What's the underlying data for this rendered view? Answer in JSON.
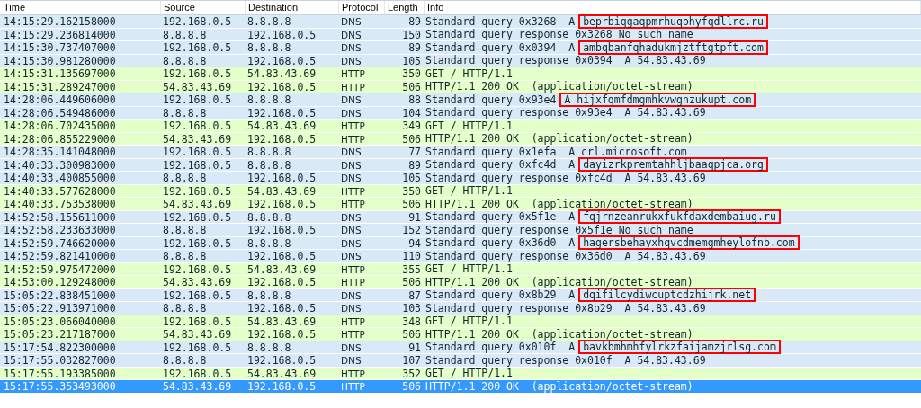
{
  "columns": [
    "Time",
    "Source",
    "Destination",
    "Protocol",
    "Length",
    "Info"
  ],
  "rows": [
    {
      "kind": "dns",
      "selected": false,
      "time": "14:15:29.162158000",
      "source": "192.168.0.5",
      "destination": "8.8.8.8",
      "protocol": "DNS",
      "length": "89",
      "info": "Standard query 0x3268  A",
      "highlight": "beprbiqgaqpmrhuqohyfqdllrc.ru"
    },
    {
      "kind": "dns",
      "selected": false,
      "time": "14:15:29.236814000",
      "source": "8.8.8.8",
      "destination": "192.168.0.5",
      "protocol": "DNS",
      "length": "150",
      "info": "Standard query response 0x3268 No such name"
    },
    {
      "kind": "dns",
      "selected": false,
      "time": "14:15:30.737407000",
      "source": "192.168.0.5",
      "destination": "8.8.8.8",
      "protocol": "DNS",
      "length": "89",
      "info": "Standard query 0x0394  A",
      "highlight": "ambqbanfqhadukmjztftgtpft.com"
    },
    {
      "kind": "dns",
      "selected": false,
      "time": "14:15:30.981280000",
      "source": "8.8.8.8",
      "destination": "192.168.0.5",
      "protocol": "DNS",
      "length": "105",
      "info": "Standard query response 0x0394  A 54.83.43.69"
    },
    {
      "kind": "http",
      "selected": false,
      "time": "14:15:31.135697000",
      "source": "192.168.0.5",
      "destination": "54.83.43.69",
      "protocol": "HTTP",
      "length": "350",
      "info": "GET / HTTP/1.1"
    },
    {
      "kind": "http",
      "selected": false,
      "time": "14:15:31.289247000",
      "source": "54.83.43.69",
      "destination": "192.168.0.5",
      "protocol": "HTTP",
      "length": "506",
      "info": "HTTP/1.1 200 OK  (application/octet-stream)"
    },
    {
      "kind": "dns",
      "selected": false,
      "time": "14:28:06.449606000",
      "source": "192.168.0.5",
      "destination": "8.8.8.8",
      "protocol": "DNS",
      "length": "88",
      "info": "Standard query 0x93e4",
      "highlight": "A hijxfqmfdmgmhkvwgnzukupt.com"
    },
    {
      "kind": "dns",
      "selected": false,
      "time": "14:28:06.549486000",
      "source": "8.8.8.8",
      "destination": "192.168.0.5",
      "protocol": "DNS",
      "length": "104",
      "info": "Standard query response 0x93e4  A 54.83.43.69"
    },
    {
      "kind": "http",
      "selected": false,
      "time": "14:28:06.702435000",
      "source": "192.168.0.5",
      "destination": "54.83.43.69",
      "protocol": "HTTP",
      "length": "349",
      "info": "GET / HTTP/1.1"
    },
    {
      "kind": "http",
      "selected": false,
      "time": "14:28:06.855229000",
      "source": "54.83.43.69",
      "destination": "192.168.0.5",
      "protocol": "HTTP",
      "length": "506",
      "info": "HTTP/1.1 200 OK  (application/octet-stream)"
    },
    {
      "kind": "dns",
      "selected": false,
      "time": "14:28:35.141048000",
      "source": "192.168.0.5",
      "destination": "8.8.8.8",
      "protocol": "DNS",
      "length": "77",
      "info": "Standard query 0x1efa  A crl.microsoft.com"
    },
    {
      "kind": "dns",
      "selected": false,
      "time": "14:40:33.300983000",
      "source": "192.168.0.5",
      "destination": "8.8.8.8",
      "protocol": "DNS",
      "length": "89",
      "info": "Standard query 0xfc4d  A",
      "highlight": "dayizrkpremtahhljbaaqpjca.org"
    },
    {
      "kind": "dns",
      "selected": false,
      "time": "14:40:33.400855000",
      "source": "8.8.8.8",
      "destination": "192.168.0.5",
      "protocol": "DNS",
      "length": "105",
      "info": "Standard query response 0xfc4d  A 54.83.43.69"
    },
    {
      "kind": "http",
      "selected": false,
      "time": "14:40:33.577628000",
      "source": "192.168.0.5",
      "destination": "54.83.43.69",
      "protocol": "HTTP",
      "length": "350",
      "info": "GET / HTTP/1.1"
    },
    {
      "kind": "http",
      "selected": false,
      "time": "14:40:33.753538000",
      "source": "54.83.43.69",
      "destination": "192.168.0.5",
      "protocol": "HTTP",
      "length": "506",
      "info": "HTTP/1.1 200 OK  (application/octet-stream)"
    },
    {
      "kind": "dns",
      "selected": false,
      "time": "14:52:58.155611000",
      "source": "192.168.0.5",
      "destination": "8.8.8.8",
      "protocol": "DNS",
      "length": "91",
      "info": "Standard query 0x5f1e  A",
      "highlight": "fqjrnzeanrukxfukfdaxdembaiug.ru"
    },
    {
      "kind": "dns",
      "selected": false,
      "time": "14:52:58.233633000",
      "source": "8.8.8.8",
      "destination": "192.168.0.5",
      "protocol": "DNS",
      "length": "152",
      "info": "Standard query response 0x5f1e No such name"
    },
    {
      "kind": "dns",
      "selected": false,
      "time": "14:52:59.746620000",
      "source": "192.168.0.5",
      "destination": "8.8.8.8",
      "protocol": "DNS",
      "length": "94",
      "info": "Standard query 0x36d0  A",
      "highlight": "hagersbehayxhqvcdmemgmheylofnb.com"
    },
    {
      "kind": "dns",
      "selected": false,
      "time": "14:52:59.821410000",
      "source": "8.8.8.8",
      "destination": "192.168.0.5",
      "protocol": "DNS",
      "length": "110",
      "info": "Standard query response 0x36d0  A 54.83.43.69"
    },
    {
      "kind": "http",
      "selected": false,
      "time": "14:52:59.975472000",
      "source": "192.168.0.5",
      "destination": "54.83.43.69",
      "protocol": "HTTP",
      "length": "355",
      "info": "GET / HTTP/1.1"
    },
    {
      "kind": "http",
      "selected": false,
      "time": "14:53:00.129248000",
      "source": "54.83.43.69",
      "destination": "192.168.0.5",
      "protocol": "HTTP",
      "length": "506",
      "info": "HTTP/1.1 200 OK  (application/octet-stream)"
    },
    {
      "kind": "dns",
      "selected": false,
      "time": "15:05:22.838451000",
      "source": "192.168.0.5",
      "destination": "8.8.8.8",
      "protocol": "DNS",
      "length": "87",
      "info": "Standard query 0x8b29  A",
      "highlight": "dqifilcydiwcuptcdzhijrk.net"
    },
    {
      "kind": "dns",
      "selected": false,
      "time": "15:05:22.913971000",
      "source": "8.8.8.8",
      "destination": "192.168.0.5",
      "protocol": "DNS",
      "length": "103",
      "info": "Standard query response 0x8b29  A 54.83.43.69"
    },
    {
      "kind": "http",
      "selected": false,
      "time": "15:05:23.066040000",
      "source": "192.168.0.5",
      "destination": "54.83.43.69",
      "protocol": "HTTP",
      "length": "348",
      "info": "GET / HTTP/1.1"
    },
    {
      "kind": "http",
      "selected": false,
      "time": "15:05:23.217187000",
      "source": "54.83.43.69",
      "destination": "192.168.0.5",
      "protocol": "HTTP",
      "length": "506",
      "info": "HTTP/1.1 200 OK  (application/octet-stream)"
    },
    {
      "kind": "dns",
      "selected": false,
      "time": "15:17:54.822300000",
      "source": "192.168.0.5",
      "destination": "8.8.8.8",
      "protocol": "DNS",
      "length": "91",
      "info": "Standard query 0x010f  A",
      "highlight": "bavkbmhmhfylrkzfaijamzjrlsg.com"
    },
    {
      "kind": "dns",
      "selected": false,
      "time": "15:17:55.032827000",
      "source": "8.8.8.8",
      "destination": "192.168.0.5",
      "protocol": "DNS",
      "length": "107",
      "info": "Standard query response 0x010f  A 54.83.43.69"
    },
    {
      "kind": "http",
      "selected": false,
      "time": "15:17:55.193385000",
      "source": "192.168.0.5",
      "destination": "54.83.43.69",
      "protocol": "HTTP",
      "length": "352",
      "info": "GET / HTTP/1.1"
    },
    {
      "selected": true,
      "time": "15:17:55.353493000",
      "source": "54.83.43.69",
      "destination": "192.168.0.5",
      "protocol": "HTTP",
      "length": "506",
      "info": "HTTP/1.1 200 OK  (application/octet-stream)"
    }
  ]
}
